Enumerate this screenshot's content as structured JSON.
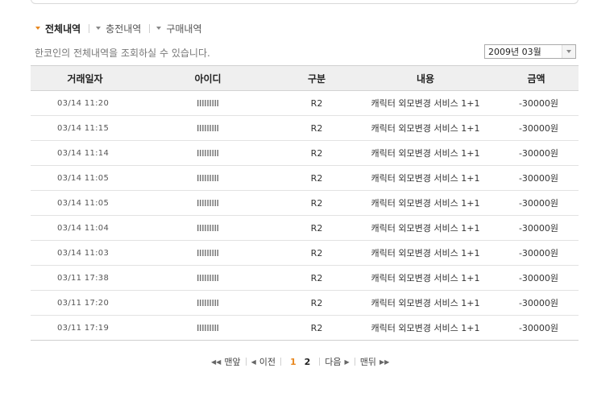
{
  "tabs": [
    {
      "label": "전체내역",
      "active": true
    },
    {
      "label": "충전내역",
      "active": false
    },
    {
      "label": "구매내역",
      "active": false
    }
  ],
  "description": "한코인의 전체내역을 조회하실 수 있습니다.",
  "date_select": {
    "value": "2009년 03월"
  },
  "table": {
    "headers": [
      "거래일자",
      "아이디",
      "구분",
      "내용",
      "금액"
    ],
    "rows": [
      [
        "03/14 11:20",
        "lllllllll",
        "R2",
        "캐릭터 외모변경 서비스 1+1",
        "-30000원"
      ],
      [
        "03/14 11:15",
        "lllllllll",
        "R2",
        "캐릭터 외모변경 서비스 1+1",
        "-30000원"
      ],
      [
        "03/14 11:14",
        "lllllllll",
        "R2",
        "캐릭터 외모변경 서비스 1+1",
        "-30000원"
      ],
      [
        "03/14 11:05",
        "lllllllll",
        "R2",
        "캐릭터 외모변경 서비스 1+1",
        "-30000원"
      ],
      [
        "03/14 11:05",
        "lllllllll",
        "R2",
        "캐릭터 외모변경 서비스 1+1",
        "-30000원"
      ],
      [
        "03/14 11:04",
        "lllllllll",
        "R2",
        "캐릭터 외모변경 서비스 1+1",
        "-30000원"
      ],
      [
        "03/14 11:03",
        "lllllllll",
        "R2",
        "캐릭터 외모변경 서비스 1+1",
        "-30000원"
      ],
      [
        "03/11 17:38",
        "lllllllll",
        "R2",
        "캐릭터 외모변경 서비스 1+1",
        "-30000원"
      ],
      [
        "03/11 17:20",
        "lllllllll",
        "R2",
        "캐릭터 외모변경 서비스 1+1",
        "-30000원"
      ],
      [
        "03/11 17:19",
        "lllllllll",
        "R2",
        "캐릭터 외모변경 서비스 1+1",
        "-30000원"
      ]
    ]
  },
  "pager": {
    "first_label": "맨앞",
    "prev_label": "이전",
    "pages": [
      "1",
      "2"
    ],
    "current_page": "1",
    "next_label": "다음",
    "last_label": "맨뒤"
  },
  "colors": {
    "accent": "#e8871e",
    "header_bg": "#efefef"
  }
}
